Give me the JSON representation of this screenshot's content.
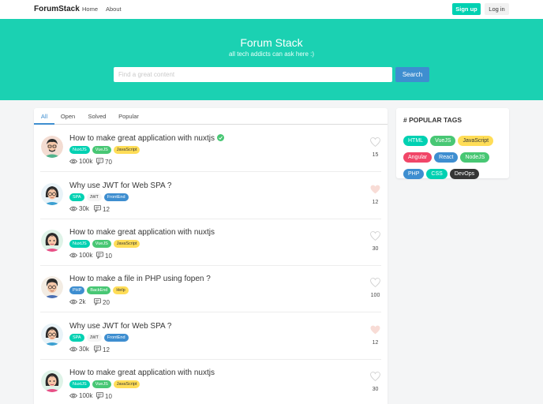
{
  "navbar": {
    "brand": "ForumStack",
    "links": [
      "Home",
      "About"
    ],
    "signup_label": "Sign up",
    "login_label": "Log in"
  },
  "hero": {
    "title": "Forum Stack",
    "subtitle": "all tech addicts can ask here :)",
    "search_placeholder": "Find a great content",
    "search_value": "",
    "search_button": "Search"
  },
  "tabs": [
    "All",
    "Open",
    "Solved",
    "Popular"
  ],
  "active_tab": "All",
  "colors": {
    "teal": "#00d1b2",
    "hero": "#1bd1b2",
    "green": "#48c774",
    "blue": "#3e8ed0",
    "yellow": "#ffdd57",
    "red": "#f14668",
    "dark": "#363636",
    "light": "#f5f5f5",
    "heart_filled": "#f8dcd6",
    "heart_outline": "#d0d0d0"
  },
  "questions": [
    {
      "title": "How to make great application with nuxtjs",
      "solved": true,
      "tags": [
        {
          "label": "NuxtJS",
          "color": "teal"
        },
        {
          "label": "VueJS",
          "color": "green"
        },
        {
          "label": "JavaScript",
          "color": "yellow"
        }
      ],
      "views": "100k",
      "comments": "70",
      "likes": "15",
      "liked": false,
      "avatar": "man-glasses-avatar"
    },
    {
      "title": "Why use JWT for Web SPA ?",
      "solved": false,
      "tags": [
        {
          "label": "SPA",
          "color": "teal"
        },
        {
          "label": "JWT",
          "color": "light"
        },
        {
          "label": "FrontEnd",
          "color": "blue"
        }
      ],
      "views": "30k",
      "comments": "12",
      "likes": "12",
      "liked": true,
      "avatar": "woman-glasses-avatar"
    },
    {
      "title": "How to make great application with nuxtjs",
      "solved": false,
      "tags": [
        {
          "label": "NuxtJS",
          "color": "teal"
        },
        {
          "label": "VueJS",
          "color": "green"
        },
        {
          "label": "JavaScript",
          "color": "yellow"
        }
      ],
      "views": "100k",
      "comments": "10",
      "likes": "30",
      "liked": false,
      "avatar": "woman-avatar"
    },
    {
      "title": "How to make a file in PHP using fopen ?",
      "solved": false,
      "tags": [
        {
          "label": "PHP",
          "color": "blue"
        },
        {
          "label": "BackEnd",
          "color": "green"
        },
        {
          "label": "Help",
          "color": "yellow"
        }
      ],
      "views": "2k",
      "comments": "20",
      "likes": "100",
      "liked": false,
      "avatar": "man-avatar"
    },
    {
      "title": "Why use JWT for Web SPA ?",
      "solved": false,
      "tags": [
        {
          "label": "SPA",
          "color": "teal"
        },
        {
          "label": "JWT",
          "color": "light"
        },
        {
          "label": "FrontEnd",
          "color": "blue"
        }
      ],
      "views": "30k",
      "comments": "12",
      "likes": "12",
      "liked": true,
      "avatar": "woman-glasses-avatar"
    },
    {
      "title": "How to make great application with nuxtjs",
      "solved": false,
      "tags": [
        {
          "label": "NuxtJS",
          "color": "teal"
        },
        {
          "label": "VueJS",
          "color": "green"
        },
        {
          "label": "JavaScript",
          "color": "yellow"
        }
      ],
      "views": "100k",
      "comments": "10",
      "likes": "30",
      "liked": false,
      "avatar": "woman-avatar"
    }
  ],
  "sidebar": {
    "title": "# POPULAR TAGS",
    "tags": [
      {
        "label": "HTML",
        "color": "teal"
      },
      {
        "label": "VueJS",
        "color": "green"
      },
      {
        "label": "JavaScript",
        "color": "yellow"
      },
      {
        "label": "Angular",
        "color": "red"
      },
      {
        "label": "React",
        "color": "blue"
      },
      {
        "label": "NodeJS",
        "color": "green"
      },
      {
        "label": "PHP",
        "color": "blue"
      },
      {
        "label": "CSS",
        "color": "teal"
      },
      {
        "label": "DevOps",
        "color": "dark"
      }
    ]
  }
}
